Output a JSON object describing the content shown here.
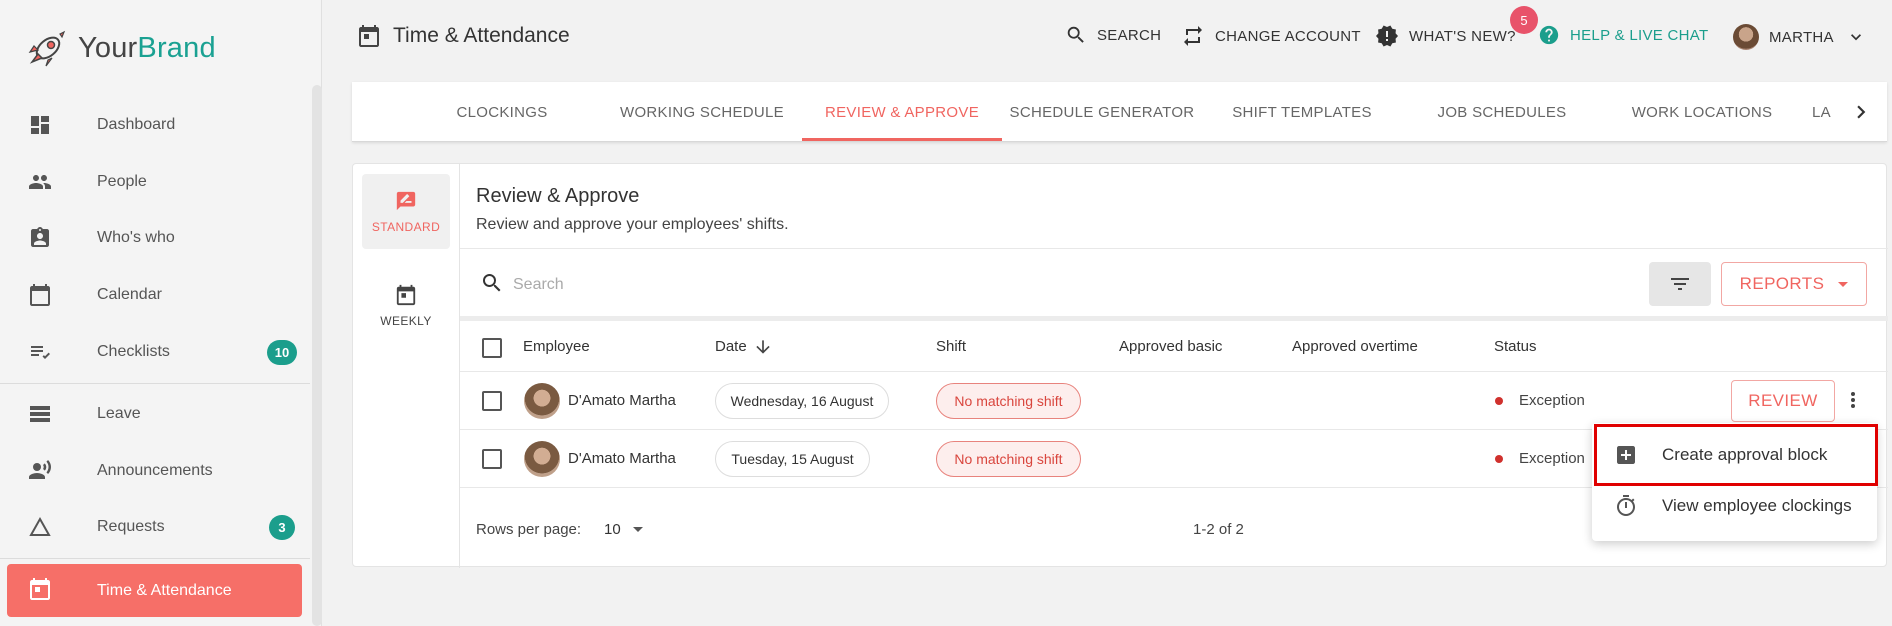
{
  "brand": {
    "part1": "Your",
    "part2": "Brand"
  },
  "sidebar": {
    "items": [
      {
        "label": "Dashboard"
      },
      {
        "label": "People"
      },
      {
        "label": "Who's who"
      },
      {
        "label": "Calendar"
      },
      {
        "label": "Checklists",
        "badge": "10"
      },
      {
        "label": "Leave"
      },
      {
        "label": "Announcements"
      },
      {
        "label": "Requests",
        "badge": "3"
      },
      {
        "label": "Time & Attendance"
      }
    ]
  },
  "header": {
    "title": "Time & Attendance",
    "search": "SEARCH",
    "change_account": "CHANGE ACCOUNT",
    "whats_new": "WHAT'S NEW?",
    "whats_new_badge": "5",
    "help": "HELP & LIVE CHAT",
    "user": "MARTHA"
  },
  "tabs": [
    {
      "label": "CLOCKINGS"
    },
    {
      "label": "WORKING SCHEDULE"
    },
    {
      "label": "REVIEW & APPROVE"
    },
    {
      "label": "SCHEDULE GENERATOR"
    },
    {
      "label": "SHIFT TEMPLATES"
    },
    {
      "label": "JOB SCHEDULES"
    },
    {
      "label": "WORK LOCATIONS"
    },
    {
      "label": "LA"
    }
  ],
  "views": {
    "standard": "STANDARD",
    "weekly": "WEEKLY"
  },
  "main": {
    "title": "Review & Approve",
    "subtitle": "Review and approve your employees' shifts.",
    "search_placeholder": "Search",
    "reports": "REPORTS"
  },
  "table": {
    "columns": {
      "employee": "Employee",
      "date": "Date",
      "shift": "Shift",
      "approved_basic": "Approved basic",
      "approved_overtime": "Approved overtime",
      "status": "Status"
    },
    "rows": [
      {
        "employee": "D'Amato Martha",
        "date": "Wednesday, 16 August",
        "shift": "No matching shift",
        "status": "Exception"
      },
      {
        "employee": "D'Amato Martha",
        "date": "Tuesday, 15 August",
        "shift": "No matching shift",
        "status": "Exception"
      }
    ],
    "review_label": "REVIEW",
    "rows_per_page_label": "Rows per page:",
    "rows_per_page": "10",
    "range": "1-2 of 2"
  },
  "menu": {
    "items": [
      {
        "label": "Create approval block"
      },
      {
        "label": "View employee clockings"
      }
    ]
  },
  "colors": {
    "accent": "#f06560",
    "teal": "#1b9e8c",
    "highlight": "#e00000"
  }
}
